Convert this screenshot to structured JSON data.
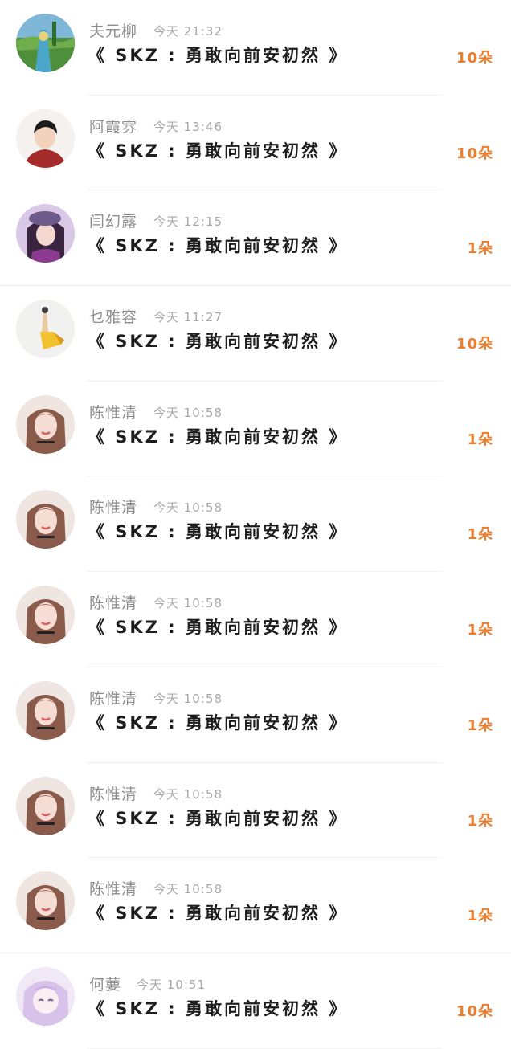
{
  "gifts": [
    {
      "user": "夫元柳",
      "time": "今天 21:32",
      "song": "《 SKZ : 勇敢向前安初然 》",
      "count": "10朵",
      "avatar": "landscape-avatar"
    },
    {
      "user": "阿霞雰",
      "time": "今天 13:46",
      "song": "《 SKZ : 勇敢向前安初然 》",
      "count": "10朵",
      "avatar": "boy-red-shirt-avatar"
    },
    {
      "user": "闫幻露",
      "time": "今天 12:15",
      "song": "《 SKZ : 勇敢向前安初然 》",
      "count": "1朵",
      "avatar": "girl-beret-avatar"
    },
    {
      "user": "乜雅容",
      "time": "今天 11:27",
      "song": "《 SKZ : 勇敢向前安初然 》",
      "count": "10朵",
      "avatar": "yellow-figure-avatar"
    },
    {
      "user": "陈惟清",
      "time": "今天 10:58",
      "song": "《 SKZ : 勇敢向前安初然 》",
      "count": "1朵",
      "avatar": "girl-braids-avatar"
    },
    {
      "user": "陈惟清",
      "time": "今天 10:58",
      "song": "《 SKZ : 勇敢向前安初然 》",
      "count": "1朵",
      "avatar": "girl-braids-avatar"
    },
    {
      "user": "陈惟清",
      "time": "今天 10:58",
      "song": "《 SKZ : 勇敢向前安初然 》",
      "count": "1朵",
      "avatar": "girl-braids-avatar"
    },
    {
      "user": "陈惟清",
      "time": "今天 10:58",
      "song": "《 SKZ : 勇敢向前安初然 》",
      "count": "1朵",
      "avatar": "girl-braids-avatar"
    },
    {
      "user": "陈惟清",
      "time": "今天 10:58",
      "song": "《 SKZ : 勇敢向前安初然 》",
      "count": "1朵",
      "avatar": "girl-braids-avatar"
    },
    {
      "user": "陈惟清",
      "time": "今天 10:58",
      "song": "《 SKZ : 勇敢向前安初然 》",
      "count": "1朵",
      "avatar": "girl-braids-avatar"
    },
    {
      "user": "何葽",
      "time": "今天 10:51",
      "song": "《 SKZ : 勇敢向前安初然 》",
      "count": "10朵",
      "avatar": "anime-girl-avatar"
    }
  ],
  "colors": {
    "count": "#ec7e2f",
    "name": "#8e8e8e",
    "time": "#a8a8a8",
    "song": "#1e1e1e"
  }
}
